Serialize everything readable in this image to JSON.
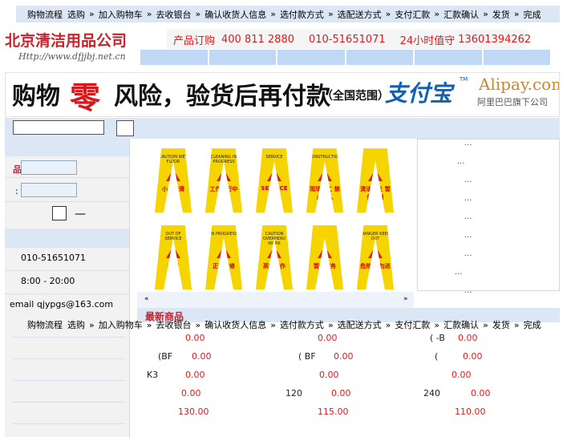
{
  "steps": [
    "购物流程",
    "选购",
    "»",
    "加入购物车",
    "»",
    "去收银台",
    "»",
    "确认收货人信息",
    "»",
    "选付款方式",
    "»",
    "选配送方式",
    "»",
    "支付汇款",
    "»",
    "汇款确认",
    "»",
    "发货",
    "»",
    "完成"
  ],
  "logo": {
    "title": "北京清洁用品公司",
    "url": "Http://www.dfjjbj.net.cn"
  },
  "hotline": {
    "order": "产品订购",
    "phone1": "400 811 2880",
    "phone2": "010-51651071",
    "duty": "24小时值守",
    "phone3": "13601394262"
  },
  "banner": {
    "part1": "购物",
    "part2": "零",
    "part3": "风险，验货后再付款",
    "part4": "（全国范围）",
    "alipay_cn": "支付宝",
    "tm": "TM",
    "alipay_en": "Alipay.com",
    "alipay_sub": "阿里巴巴旗下公司"
  },
  "sidebar": {
    "red_char": "品",
    "colon": ":",
    "dash": "—",
    "phone": "010-51651071",
    "hours": "8:00 - 20:00",
    "email": "email qjypgs@163.com"
  },
  "product_signs": [
    {
      "en": "CAUTION WET FLOOR",
      "cn": "小心地滑"
    },
    {
      "en": "CLEANING IN PROGRESS",
      "cn": "工作进行中"
    },
    {
      "en": "SERVICE",
      "cn": "SERVICE"
    },
    {
      "en": "CONSTRUCTION",
      "cn": "现场施工 禁止进入"
    },
    {
      "en": "",
      "cn": "清洁卫生 暂停使用"
    },
    {
      "en": "OUT OF SERVICE",
      "cn": "停用"
    },
    {
      "en": "IN PROGRESS",
      "cn": "正在维修"
    },
    {
      "en": "CAUTION OVERHEAD WORK",
      "cn": "高空工作"
    },
    {
      "en": "",
      "cn": "暂停服务"
    },
    {
      "en": "DANGER KEEP OUT",
      "cn": "危险 请勿进入"
    }
  ],
  "right_items": [
    "...",
    "...",
    "...",
    "...",
    "...",
    "...",
    "...",
    "...",
    "..."
  ],
  "arrows": {
    "left": "«",
    "right": "»"
  },
  "new_products": {
    "title": "最新商品",
    "rows": [
      {
        "cells": [
          {
            "label": "",
            "price": "0.00"
          },
          {
            "label": "",
            "price": "0.00"
          },
          {
            "label": "( -B",
            "price": "0.00"
          }
        ]
      },
      {
        "cells": [
          {
            "label": "(BF",
            "price": "0.00"
          },
          {
            "label": "( BF",
            "price": "0.00"
          },
          {
            "label": "(",
            "price": "0.00"
          }
        ]
      },
      {
        "cells": [
          {
            "label": "K3",
            "price": "0.00"
          },
          {
            "label": "",
            "price": "0.00"
          },
          {
            "label": "",
            "price": "0.00"
          }
        ]
      },
      {
        "cells": [
          {
            "label": "",
            "price": "0.00"
          },
          {
            "label": "120",
            "price": "0.00"
          },
          {
            "label": "240",
            "price": "0.00"
          }
        ]
      },
      {
        "cells": [
          {
            "label": "",
            "price": "130.00"
          },
          {
            "label": "",
            "price": "115.00"
          },
          {
            "label": "",
            "price": "110.00"
          }
        ]
      }
    ]
  },
  "colors": {
    "accent_red": "#e01b1b",
    "light_blue": "#dce7f5",
    "nav_blue": "#bfd8f6"
  }
}
